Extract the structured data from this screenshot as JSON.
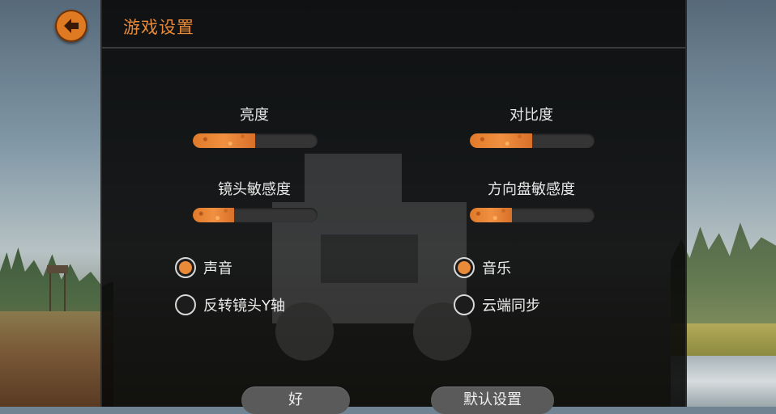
{
  "header": {
    "title": "游戏设置"
  },
  "sliders": [
    {
      "label": "亮度",
      "level": 0.5
    },
    {
      "label": "对比度",
      "level": 0.5
    },
    {
      "label": "镜头敏感度",
      "level": 0.33
    },
    {
      "label": "方向盘敏感度",
      "level": 0.34
    }
  ],
  "options": [
    {
      "label": "声音",
      "checked": true
    },
    {
      "label": "音乐",
      "checked": true
    },
    {
      "label": "反转镜头Y轴",
      "checked": false
    },
    {
      "label": "云端同步",
      "checked": false
    }
  ],
  "buttons": {
    "ok": "好",
    "defaults": "默认设置"
  },
  "colors": {
    "accent": "#e98a38",
    "panel": "#0a0a0a",
    "track": "#353535"
  },
  "icons": {
    "back": "back-arrow-icon"
  }
}
